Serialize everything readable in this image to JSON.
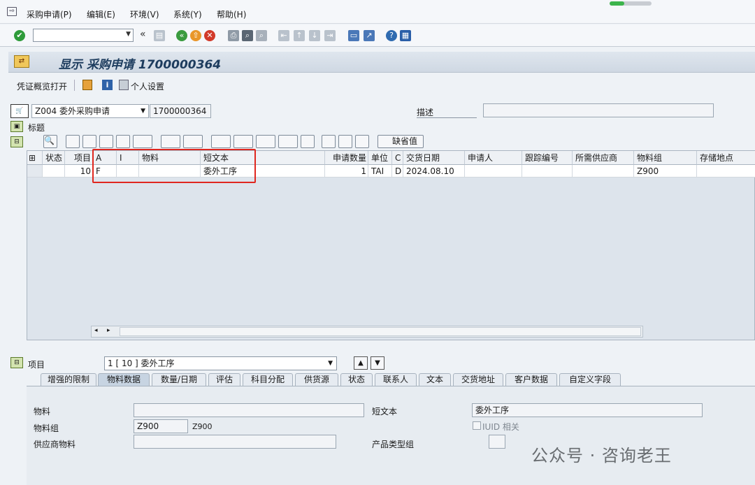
{
  "menubar": {
    "items": [
      "采购申请(P)",
      "编辑(E)",
      "环境(V)",
      "系统(Y)",
      "帮助(H)"
    ],
    "progress": 0.35
  },
  "toolbar": {
    "command_value": "",
    "back_glyph": "«",
    "icons": [
      "enter-icon",
      "save-icon",
      "back-icon",
      "exit-icon",
      "cancel-icon",
      "print-icon",
      "find-icon",
      "find-next-icon",
      "first-page-icon",
      "prev-page-icon",
      "next-page-icon",
      "last-page-icon",
      "new-session-icon",
      "shortcut-icon",
      "help-icon",
      "customize-layout-icon"
    ]
  },
  "title": {
    "text": "显示 采购申请 1700000364"
  },
  "app_toolbar": {
    "overview_label": "凭证概览打开",
    "personal_settings_label": "个人设置"
  },
  "header": {
    "doc_type": "Z004 委外采购申请",
    "doc_number": "1700000364",
    "description_label": "描述",
    "description_value": "",
    "section_label": "标题"
  },
  "grid_toolbar": {
    "default_values_label": "缺省值"
  },
  "grid": {
    "columns": [
      "状态",
      "项目",
      "A",
      "I",
      "物料",
      "短文本",
      "申请数量",
      "单位",
      "C",
      "交货日期",
      "申请人",
      "跟踪编号",
      "所需供应商",
      "物料组",
      "存储地点"
    ],
    "rows": [
      {
        "status": "",
        "item": "10",
        "a": "F",
        "i": "",
        "material": "",
        "short_text": "委外工序",
        "qty": "1",
        "unit": "TAI",
        "c": "D",
        "delivery_date": "2024.08.10",
        "requisitioner": "",
        "tracking": "",
        "supplier": "",
        "material_group": "Z900",
        "storage": ""
      }
    ]
  },
  "item_section": {
    "label": "项目",
    "selected": "1 [ 10 ] 委外工序"
  },
  "tabs": [
    "增强的限制",
    "物料数据",
    "数量/日期",
    "评估",
    "科目分配",
    "供货源",
    "状态",
    "联系人",
    "文本",
    "交货地址",
    "客户数据",
    "自定义字段"
  ],
  "active_tab": "物料数据",
  "material_data": {
    "material_label": "物料",
    "material_value": "",
    "short_text_label": "短文本",
    "short_text_value": "委外工序",
    "material_group_label": "物料组",
    "material_group_value": "Z900",
    "material_group_desc": "Z900",
    "iuid_label": "IUID 相关",
    "supplier_material_label": "供应商物料",
    "supplier_material_value": "",
    "product_type_group_label": "产品类型组",
    "product_type_group_value": ""
  },
  "watermark": "公众号 · 咨询老王"
}
